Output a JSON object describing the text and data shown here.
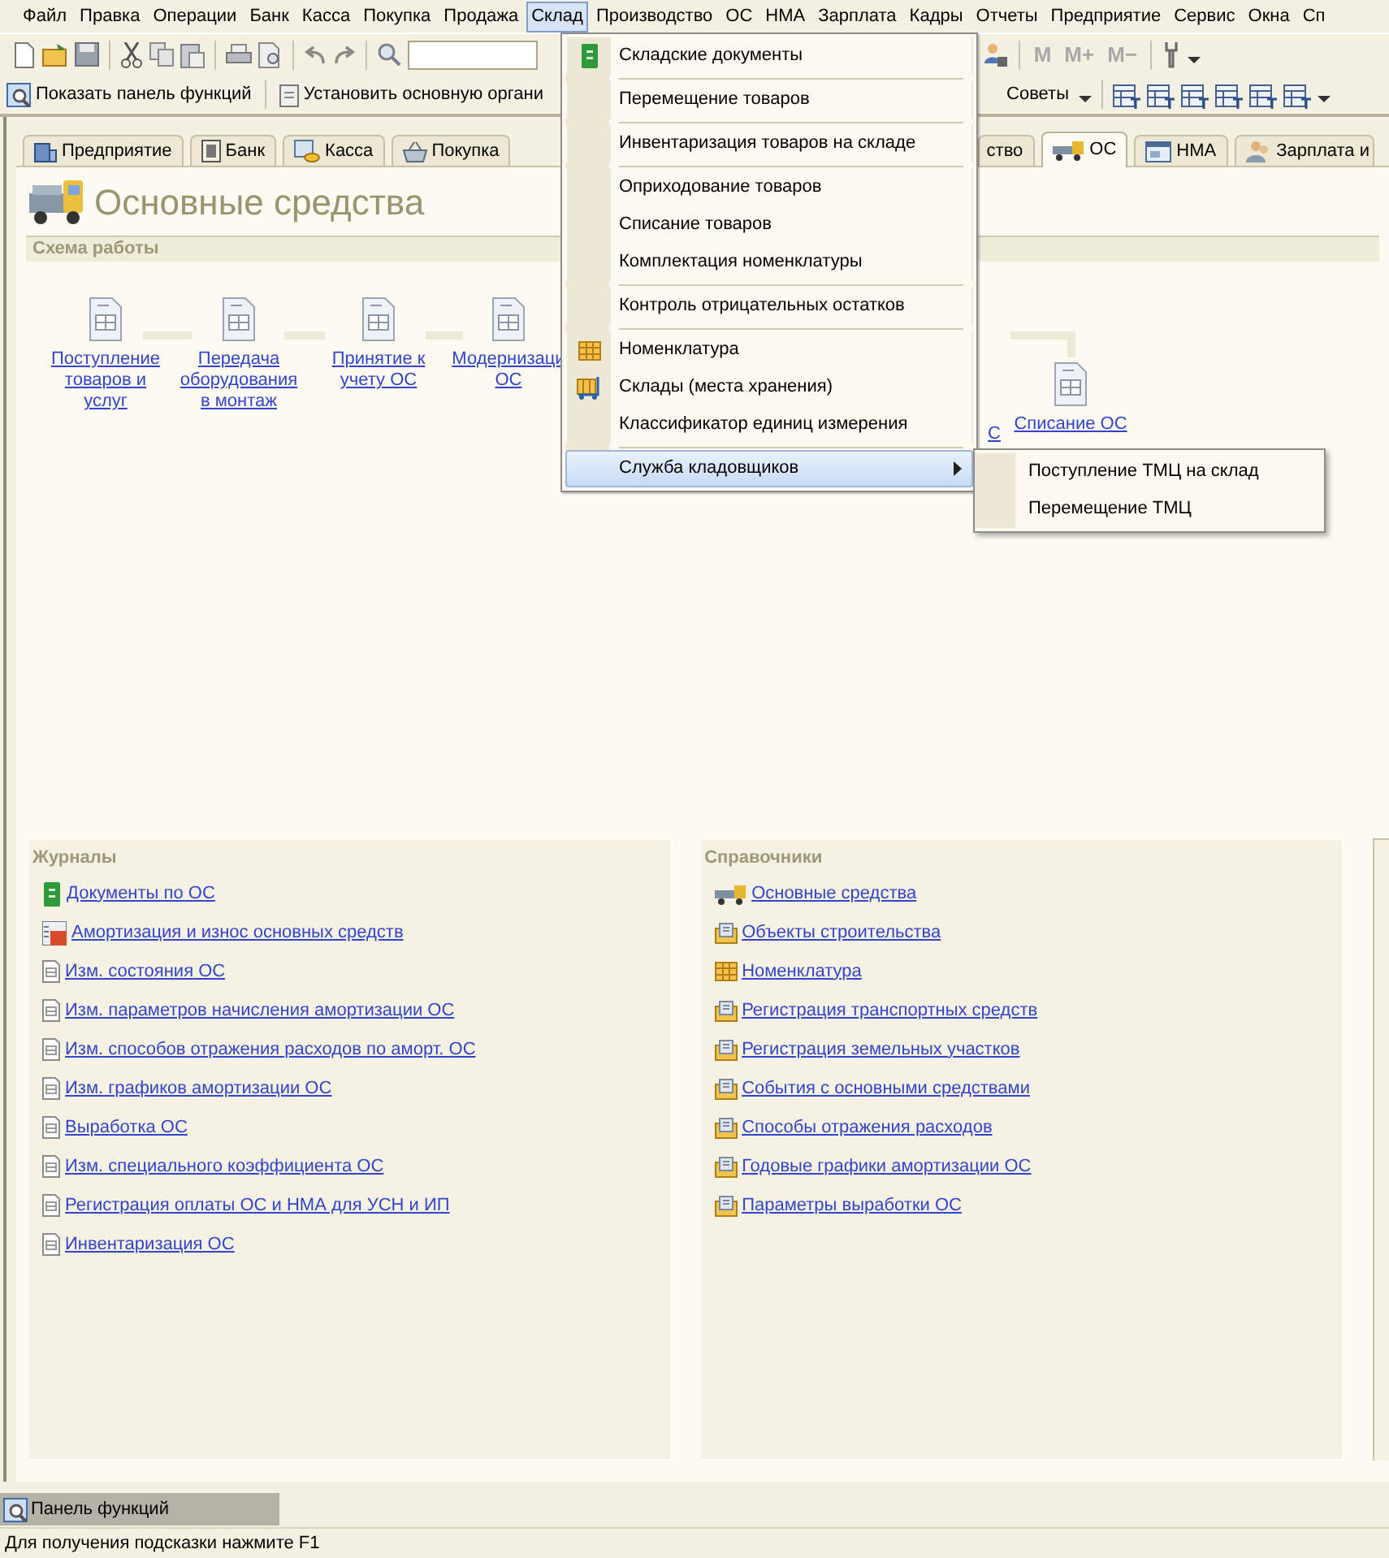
{
  "menu_bar": [
    {
      "label": "Файл",
      "selected": false
    },
    {
      "label": "Правка",
      "selected": false
    },
    {
      "label": "Операции",
      "selected": false
    },
    {
      "label": "Банк",
      "selected": false
    },
    {
      "label": "Касса",
      "selected": false
    },
    {
      "label": "Покупка",
      "selected": false
    },
    {
      "label": "Продажа",
      "selected": false
    },
    {
      "label": "Склад",
      "selected": true
    },
    {
      "label": "Производство",
      "selected": false
    },
    {
      "label": "ОС",
      "selected": false
    },
    {
      "label": "НМА",
      "selected": false
    },
    {
      "label": "Зарплата",
      "selected": false
    },
    {
      "label": "Кадры",
      "selected": false
    },
    {
      "label": "Отчеты",
      "selected": false
    },
    {
      "label": "Предприятие",
      "selected": false
    },
    {
      "label": "Сервис",
      "selected": false
    },
    {
      "label": "Окна",
      "selected": false
    },
    {
      "label": "Сп",
      "selected": false
    }
  ],
  "toolbar": {
    "memory_buttons": [
      {
        "label": "M",
        "disabled": true
      },
      {
        "label": "M+",
        "disabled": true
      },
      {
        "label": "M−",
        "disabled": true
      }
    ]
  },
  "command_bar": {
    "buttons": [
      "Показать панель функций",
      "Установить основную органи",
      "Советы"
    ]
  },
  "tabs": [
    {
      "label": "Предприятие",
      "selected": false
    },
    {
      "label": "Банк",
      "selected": false
    },
    {
      "label": "Касса",
      "selected": false
    },
    {
      "label": "Покупка",
      "selected": false
    },
    {
      "label": "ство",
      "selected": false
    },
    {
      "label": "ОС",
      "selected": true
    },
    {
      "label": "НМА",
      "selected": false
    },
    {
      "label": "Зарплата и",
      "selected": false
    }
  ],
  "panel": {
    "title": "Основные средства",
    "scheme": {
      "title": "Схема работы",
      "nodes": [
        {
          "lines": [
            "Поступление",
            "товаров и",
            "услуг"
          ]
        },
        {
          "lines": [
            "Передача",
            "оборудования",
            "в монтаж"
          ]
        },
        {
          "lines": [
            "Принятие к",
            "учету ОС"
          ]
        },
        {
          "lines": [
            "Модернизаци",
            "ОС"
          ]
        },
        {
          "lines": [
            "С"
          ]
        },
        {
          "lines": [
            "Списание ОС"
          ]
        }
      ]
    },
    "journals": {
      "title": "Журналы",
      "links": [
        "Документы по ОС",
        "Амортизация и износ основных средств",
        "Изм. состояния ОС",
        "Изм. параметров начисления амортизации ОС",
        "Изм. способов отражения расходов по аморт. ОС",
        "Изм. графиков амортизации ОС",
        "Выработка ОС",
        "Изм. специального коэффициента ОС",
        "Регистрация оплаты ОС и НМА для УСН и ИП",
        "Инвентаризация ОС"
      ]
    },
    "catalogs": {
      "title": "Справочники",
      "links": [
        "Основные средства",
        "Объекты строительства",
        "Номенклатура",
        "Регистрация транспортных средств",
        "Регистрация земельных участков",
        "События с основными средствами",
        "Способы отражения расходов",
        "Годовые графики амортизации ОС",
        "Параметры выработки ОС"
      ]
    }
  },
  "dropdown_menu": {
    "groups": [
      [
        {
          "label": "Складские документы",
          "selected": false
        }
      ],
      [
        {
          "label": "Перемещение товаров",
          "selected": false
        }
      ],
      [
        {
          "label": "Инвентаризация товаров на складе",
          "selected": false
        }
      ],
      [
        {
          "label": "Оприходование товаров",
          "selected": false
        },
        {
          "label": "Списание товаров",
          "selected": false
        },
        {
          "label": "Комплектация номенклатуры",
          "selected": false
        }
      ],
      [
        {
          "label": "Контроль отрицательных остатков",
          "selected": false
        }
      ],
      [
        {
          "label": "Номенклатура",
          "selected": false
        },
        {
          "label": "Склады (места хранения)",
          "selected": false
        },
        {
          "label": "Классификатор единиц измерения",
          "selected": false
        }
      ],
      [
        {
          "label": "Служба кладовщиков",
          "selected": true,
          "submenu": [
            "Поступление ТМЦ на склад",
            "Перемещение ТМЦ"
          ]
        }
      ]
    ]
  },
  "function_panel_tab": "Панель функций",
  "status_bar": "Для получения подсказки нажмите F1"
}
